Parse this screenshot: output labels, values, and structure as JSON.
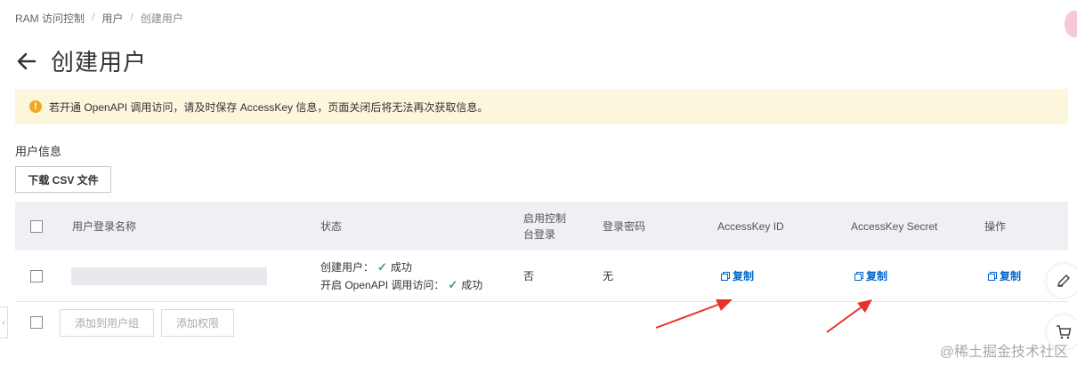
{
  "breadcrumb": {
    "items": [
      "RAM 访问控制",
      "用户",
      "创建用户"
    ]
  },
  "page": {
    "title": "创建用户"
  },
  "notice": {
    "icon": "warning-icon",
    "text": "若开通 OpenAPI 调用访问，请及时保存 AccessKey 信息，页面关闭后将无法再次获取信息。"
  },
  "section": {
    "title": "用户信息",
    "download_label": "下载 CSV 文件"
  },
  "table": {
    "headers": {
      "name": "用户登录名称",
      "status": "状态",
      "console_line1": "启用控制",
      "console_line2": "台登录",
      "password": "登录密码",
      "ak_id": "AccessKey ID",
      "ak_secret": "AccessKey Secret",
      "action": "操作"
    },
    "rows": [
      {
        "name": "",
        "status_create": "创建用户：",
        "status_create_result": "成功",
        "status_openapi": "开启 OpenAPI 调用访问：",
        "status_openapi_result": "成功",
        "console": "否",
        "password": "无",
        "ak_id_action": "复制",
        "ak_secret_action": "复制",
        "op_action": "复制"
      }
    ]
  },
  "footer": {
    "add_to_group": "添加到用户组",
    "add_permission": "添加权限"
  },
  "colors": {
    "accent": "#0066cc",
    "notice_bg": "#fcf6dc",
    "arrow": "#e8312a",
    "success": "#3ba55c"
  },
  "watermark": "@稀土掘金技术社区"
}
